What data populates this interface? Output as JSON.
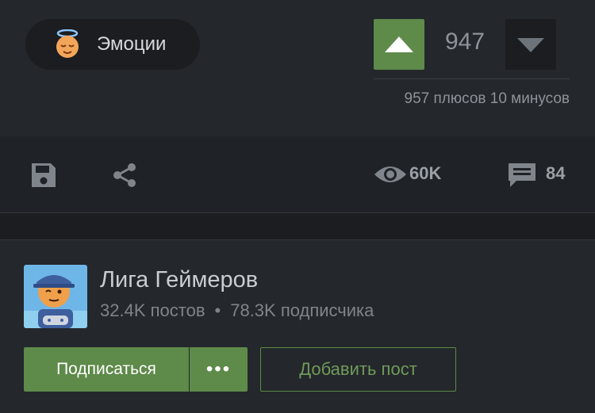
{
  "post": {
    "tag": {
      "label": "Эмоции",
      "icon": "halo-face-emoji-icon"
    },
    "vote": {
      "score": "947",
      "stats": "957 плюсов 10 минусов",
      "up_icon": "arrow-up-icon",
      "down_icon": "arrow-down-icon"
    },
    "actions": {
      "save_icon": "save-icon",
      "share_icon": "share-icon",
      "views": "60K",
      "comments": "84"
    }
  },
  "community": {
    "name": "Лига Геймеров",
    "posts": "32.4K постов",
    "separator": "•",
    "subscribers": "78.3K подписчика",
    "subscribe_label": "Подписаться",
    "more_label": "•••",
    "add_post_label": "Добавить пост"
  },
  "colors": {
    "accent_green": "#5e8a4a",
    "background": "#1f2226",
    "panel": "#24272b"
  }
}
